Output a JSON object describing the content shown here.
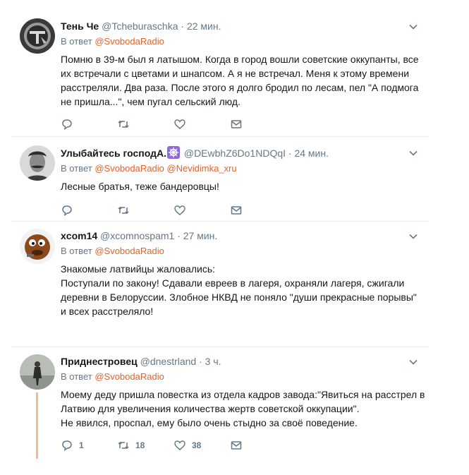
{
  "tweets": [
    {
      "name": "Тень Че",
      "handle": "@Tcheburaschka",
      "time": "22 мин.",
      "reply_prefix": "В ответ",
      "reply_to": [
        "@SvobodaRadio"
      ],
      "lines": [
        "Помню в 39-м был я латышом. Когда в город вошли советские оккупанты, все",
        "их встречали с цветами и шнапсом. А я не встречал. Меня к этому времени",
        "расстреляли. Два раза. После этого я долго бродил по лесам, пел \"А подмога",
        "не пришла...\", чем пугал сельский люд."
      ],
      "counts": {
        "reply": "",
        "retweet": "",
        "like": ""
      }
    },
    {
      "name": "Улыбайтесь господА.",
      "name_emoji": "ship-wheel-emoji",
      "handle": "@DEwbhZ6Do1NDQqI",
      "time": "24 мин.",
      "reply_prefix": "В ответ",
      "reply_to": [
        "@SvobodaRadio",
        "@Nevidimka_xru"
      ],
      "lines": [
        "Лесные братья, теже бандеровцы!"
      ],
      "counts": {
        "reply": "",
        "retweet": "",
        "like": ""
      }
    },
    {
      "name": "xcom14",
      "handle": "@xcomnospam1",
      "time": "27 мин.",
      "reply_prefix": "В ответ",
      "reply_to": [
        "@SvobodaRadio"
      ],
      "lines": [
        "Знакомые латвийцы жаловались:",
        "Поступали по закону! Сдавали евреев в лагеря, охраняли лагеря, сжигали",
        "деревни в Белоруссии. Злобное НКВД не поняло \"души прекрасные порывы\"",
        "и всех расстреляло!"
      ],
      "counts": {
        "reply": "",
        "retweet": "",
        "like": ""
      }
    },
    {
      "name": "Приднестровец",
      "handle": "@dnestrland",
      "time": "3 ч.",
      "reply_prefix": "В ответ",
      "reply_to": [
        "@SvobodaRadio"
      ],
      "lines": [
        "Моему деду пришла повестка из отдела кадров завода:\"Явиться на расстрел в",
        "Латвию для увеличения количества жертв советской оккупации\".",
        "Не явился, проспал, ему было очень стыдно за своё поведение."
      ],
      "counts": {
        "reply": "1",
        "retweet": "18",
        "like": "38"
      }
    }
  ],
  "colors": {
    "link": "#e0632b",
    "muted": "#657786",
    "thread": "#f0b99a"
  }
}
